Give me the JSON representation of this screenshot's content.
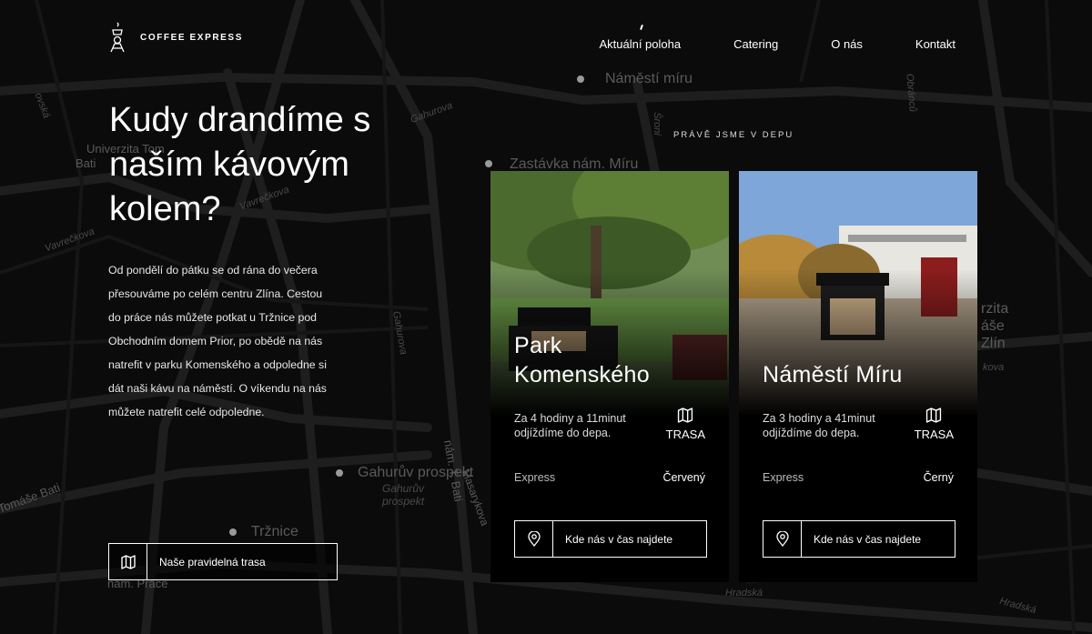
{
  "brand": {
    "name": "COFFEE EXPRESS"
  },
  "nav": [
    {
      "label": "Aktuální poloha",
      "active": true
    },
    {
      "label": "Catering"
    },
    {
      "label": "O nás"
    },
    {
      "label": "Kontakt"
    }
  ],
  "map_labels": {
    "namesti_miru": "Náměstí míru",
    "zastavka": "Zastávka nám. Míru",
    "univerzita": "Univerzita Tom",
    "bati": "Bati",
    "gahurova_1": "Gahurova",
    "gahurova_2": "Gahurova",
    "vavreckova_1": "Vavrečkova",
    "vavreckova_2": "Vavrečkova",
    "gahuruv_prospekt": "Gahurův prospekt",
    "gahuruv_small": "Gahurův prospekt",
    "trznice": "Tržnice",
    "tomase_bati": "Tomáše Bati",
    "nam_prace": "nám. Práce",
    "nam_t_bati": "nám. T. Bati",
    "masarykova": "Masarykova",
    "hradska_1": "Hradská",
    "hradska_2": "Hradská",
    "ovska": "ovská",
    "zlin": "rzita\náše\nZlín",
    "kova": "kova",
    "sroni": "Šroni",
    "obrancu": "Obránců"
  },
  "hero": {
    "title": "Kudy drandíme s naším kávovým kolem?",
    "text": "Od pondělí do pátku se od rána do večera přesouváme po celém centru Zlína. Cestou do práce nás můžete potkat u Tržnice pod Obchodním domem Prior, po obědě na nás natrefit v parku Komenského a odpoledne si dát naši kávu na náměstí. O víkendu na nás můžete natrefit celé odpoledne.",
    "route_button": "Naše pravidelná trasa"
  },
  "depot_label": "PRÁVĚ JSME V DEPU",
  "cards": [
    {
      "place": "Park Komenského",
      "eta": "Za 4 hodiny a 11minut odjíždíme do depa.",
      "trasa": "TRASA",
      "meta_label": "Express",
      "meta_value": "Červený",
      "button": "Kde nás v čas najdete"
    },
    {
      "place": "Náměstí Míru",
      "eta": "Za 3 hodiny a 41minut odjíždíme do depa.",
      "trasa": "TRASA",
      "meta_label": "Express",
      "meta_value": "Černý",
      "button": "Kde nás v čas najdete"
    }
  ],
  "icons": {
    "logo": "coffee-express-logo-icon",
    "map": "map-icon",
    "pin": "location-pin-icon"
  }
}
